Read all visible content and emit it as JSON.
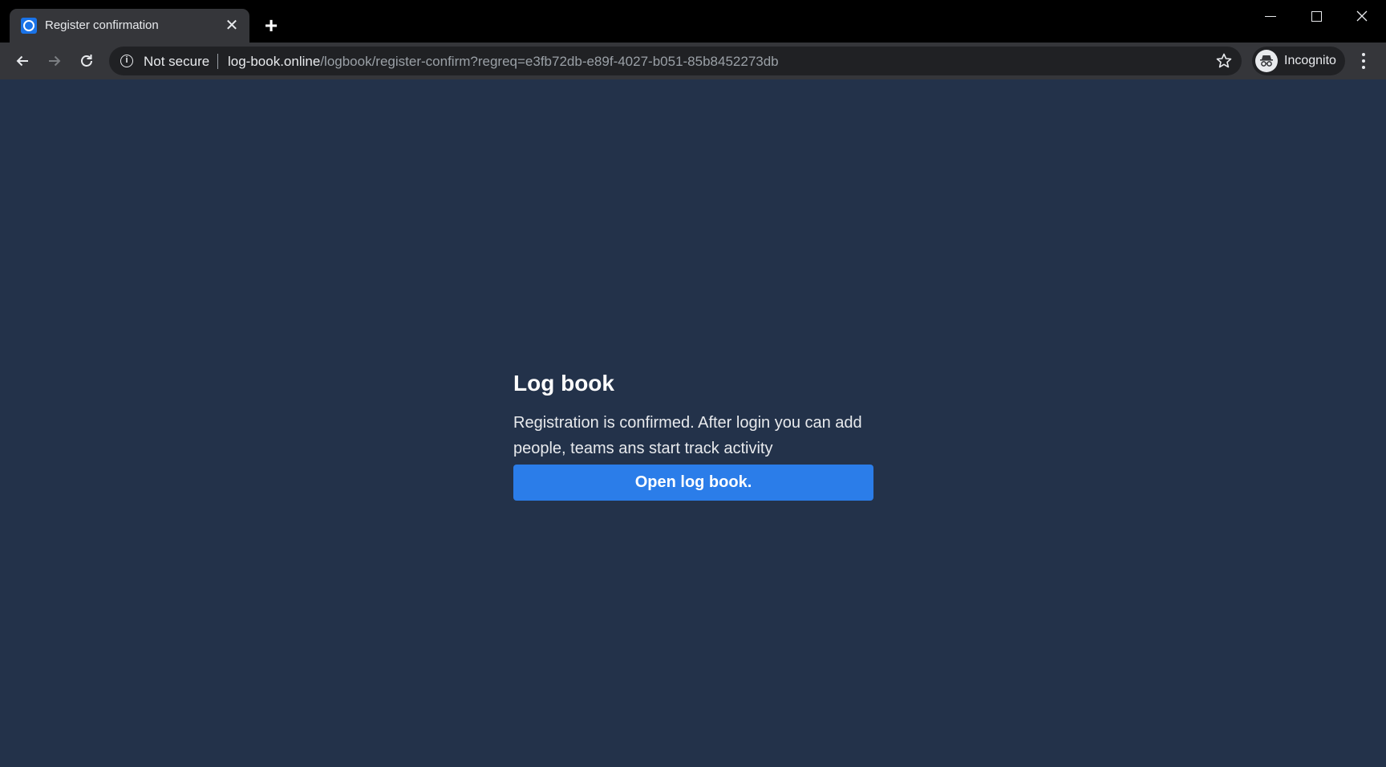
{
  "browser": {
    "tab": {
      "title": "Register confirmation",
      "favicon": "page-favicon",
      "close_glyph": "✕"
    },
    "new_tab_glyph": "+",
    "window_controls": [
      "minimize",
      "maximize",
      "close"
    ],
    "toolbar": {
      "back_icon": "arrow-left-icon",
      "forward_icon": "arrow-right-icon",
      "reload_icon": "reload-icon"
    },
    "omnibox": {
      "security_icon": "info-icon",
      "security_label": "Not secure",
      "url_host": "log-book.online",
      "url_path": "/logbook/register-confirm?regreq=e3fb72db-e89f-4027-b051-85b8452273db",
      "bookmark_icon": "star-icon"
    },
    "profile": {
      "label": "Incognito",
      "icon": "incognito-icon"
    },
    "menu_icon": "kebab-menu-icon"
  },
  "page": {
    "heading": "Log book",
    "message": "Registration is confirmed. After login you can add people, teams ans start track activity",
    "button_label": "Open log book.",
    "colors": {
      "background": "#23324a",
      "button": "#2b7de9"
    }
  }
}
